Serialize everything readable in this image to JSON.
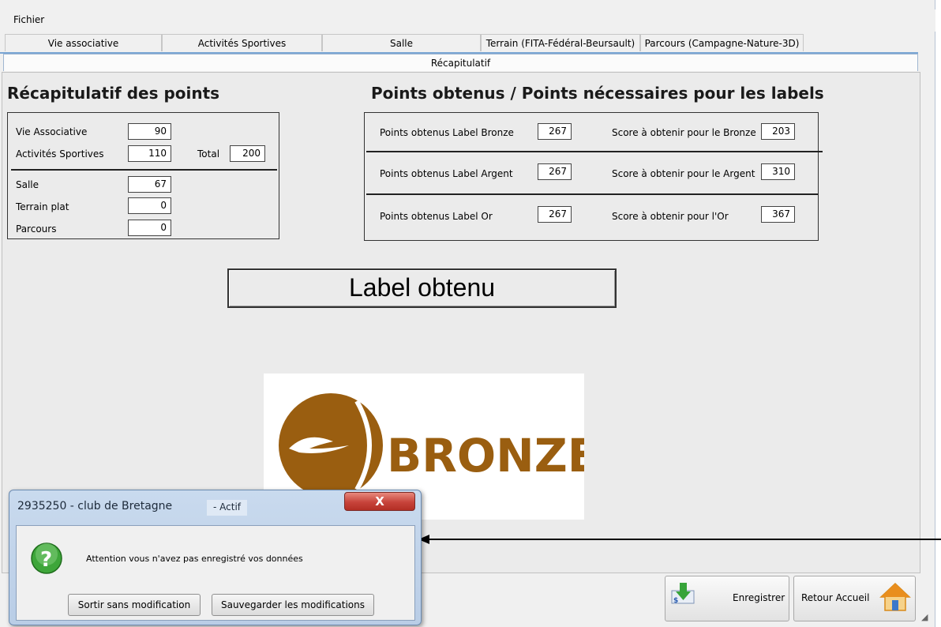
{
  "menu": {
    "file": "Fichier"
  },
  "tabs": [
    "Vie associative",
    "Activités Sportives",
    "Salle",
    "Terrain (FITA-Fédéral-Beursault)",
    "Parcours (Campagne-Nature-3D)"
  ],
  "active_tab": "Récapitulatif",
  "recap": {
    "heading": "Récapitulatif des points",
    "vie_label": "Vie Associative",
    "vie_value": "90",
    "activites_label": "Activités Sportives",
    "activites_value": "110",
    "total_label": "Total",
    "total_value": "200",
    "salle_label": "Salle",
    "salle_value": "67",
    "terrain_label": "Terrain plat",
    "terrain_value": "0",
    "parcours_label": "Parcours",
    "parcours_value": "0"
  },
  "labels_section": {
    "heading": "Points obtenus / Points nécessaires pour les labels",
    "bronze_obtained_label": "Points obtenus Label Bronze",
    "bronze_obtained": "267",
    "bronze_needed_label": "Score à obtenir pour le Bronze",
    "bronze_needed": "203",
    "argent_obtained_label": "Points obtenus Label Argent",
    "argent_obtained": "267",
    "argent_needed_label": "Score à obtenir pour le Argent",
    "argent_needed": "310",
    "or_obtained_label": "Points obtenus Label Or",
    "or_obtained": "267",
    "or_needed_label": "Score à obtenir pour l'Or",
    "or_needed": "367"
  },
  "label_obtenu": "Label obtenu",
  "logo_text": "BRONZE",
  "buttons": {
    "save": "Enregistrer",
    "home": "Retour Accueil"
  },
  "dialog": {
    "title": "2935250 - club de Bretagne",
    "status": "- Actif",
    "message": "Attention vous n'avez pas enregistré vos données",
    "btn_exit": "Sortir sans modification",
    "btn_save": "Sauvegarder les modifications",
    "close_glyph": "X"
  },
  "colors": {
    "bronze": "#9a5e10",
    "accent_blue": "#7aa6d4",
    "close_red": "#c7433a"
  }
}
